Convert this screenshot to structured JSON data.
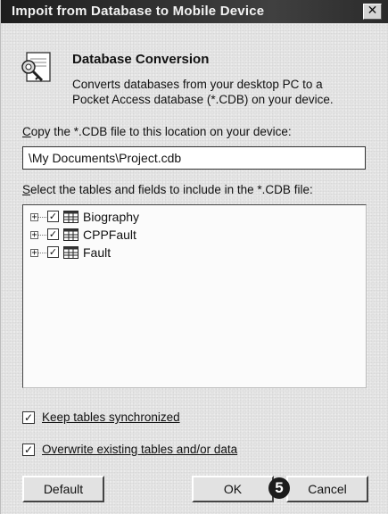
{
  "window": {
    "title": "Impoit from Database to Mobile Device",
    "close_symbol": "✕"
  },
  "header": {
    "icon": "database-conversion-icon",
    "heading": "Database Conversion",
    "description_line1": "Converts databases from your desktop PC to a",
    "description_line2": "Pocket Access database (*.CDB) on your device."
  },
  "location": {
    "label_first": "C",
    "label_rest": "opy the *.CDB file to this location on your device:",
    "value": "\\My Documents\\Project.cdb"
  },
  "tables": {
    "label_first": "S",
    "label_rest": "elect the tables and fields to include in the *.CDB file:",
    "items": [
      {
        "label": "Biography",
        "checked": true,
        "expander": "+"
      },
      {
        "label": "CPPFault",
        "checked": true,
        "expander": "+"
      },
      {
        "label": "Fault",
        "checked": true,
        "expander": "+"
      }
    ],
    "check_mark": "✓"
  },
  "options": {
    "keep_sync_label": "Keep tables synchronized",
    "keep_sync_checked": true,
    "overwrite_label": "Overwrite existing tables and/or data",
    "overwrite_checked": true,
    "check_mark": "✓"
  },
  "buttons": {
    "default": "Default",
    "ok": "OK",
    "cancel": "Cancel"
  },
  "callout_badge": "5"
}
